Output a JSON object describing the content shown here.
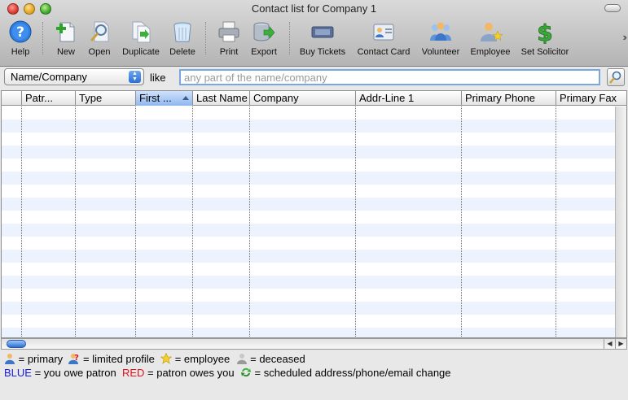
{
  "window": {
    "title": "Contact list for Company 1"
  },
  "toolbar": {
    "items": [
      {
        "id": "help",
        "label": "Help",
        "icon": "help-icon"
      },
      {
        "id": "new",
        "label": "New",
        "icon": "new-document-icon"
      },
      {
        "id": "open",
        "label": "Open",
        "icon": "open-magnifier-icon"
      },
      {
        "id": "duplicate",
        "label": "Duplicate",
        "icon": "duplicate-icon"
      },
      {
        "id": "delete",
        "label": "Delete",
        "icon": "trash-icon"
      },
      {
        "id": "print",
        "label": "Print",
        "icon": "printer-icon"
      },
      {
        "id": "export",
        "label": "Export",
        "icon": "export-database-icon"
      },
      {
        "id": "buy_tickets",
        "label": "Buy Tickets",
        "icon": "ticket-icon"
      },
      {
        "id": "contact_card",
        "label": "Contact Card",
        "icon": "contact-card-icon"
      },
      {
        "id": "volunteer",
        "label": "Volunteer",
        "icon": "volunteer-group-icon"
      },
      {
        "id": "employee",
        "label": "Employee",
        "icon": "employee-icon"
      },
      {
        "id": "set_solicitor",
        "label": "Set Solicitor",
        "icon": "dollar-sign-icon"
      }
    ]
  },
  "search": {
    "field_value": "Name/Company",
    "operator_label": "like",
    "placeholder": "any part of the name/company",
    "value": ""
  },
  "table": {
    "columns": [
      "Patr...",
      "Type",
      "First ...",
      "Last Name",
      "Company",
      "Addr-Line 1",
      "Primary Phone",
      "Primary Fax"
    ],
    "sorted_column": "First ...",
    "rows": []
  },
  "legend": {
    "primary": "= primary",
    "limited": "= limited profile",
    "employee": "= employee",
    "deceased": "= deceased",
    "blue_word": "BLUE",
    "blue_text": "= you owe patron",
    "red_word": "RED",
    "red_text": "= patron owes you",
    "change_text": "= scheduled address/phone/email change"
  },
  "colors": {
    "blue": "#1a1adb",
    "red": "#e0121b",
    "row_stripe": "#edf3fe",
    "sorted_header": "#8fb7ee"
  }
}
